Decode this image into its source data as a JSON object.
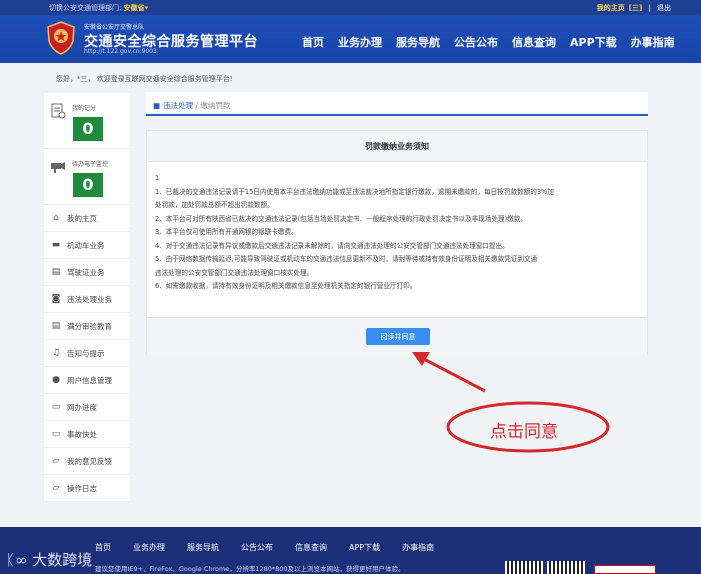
{
  "topbar": {
    "switch_label": "切换公安交通管理部门:",
    "province": "安徽省",
    "home_link": "我的主页",
    "home_sub": "[三]",
    "logout": "退出"
  },
  "header": {
    "org": "安徽省公安厅交警总队",
    "title": "交通安全综合服务管理平台",
    "url": "http://t.122.gov.cn:9003",
    "nav": [
      "首页",
      "业务办理",
      "服务导航",
      "公告公布",
      "信息查询",
      "APP下载",
      "办事指南"
    ]
  },
  "welcome": "您好，*三，  欢迎登录互联网交通安全综合服务管理平台!",
  "sidebar": {
    "score_label": "我的记分",
    "score_value": "0",
    "monitor_label": "待办电子监控",
    "monitor_value": "0",
    "items": [
      {
        "label": "我的主页",
        "icon": "home-icon"
      },
      {
        "label": "机动车业务",
        "icon": "car-icon"
      },
      {
        "label": "驾驶证业务",
        "icon": "license-icon"
      },
      {
        "label": "违法处理业务",
        "icon": "camera-icon"
      },
      {
        "label": "满分审验教育",
        "icon": "card-icon"
      },
      {
        "label": "告知与提示",
        "icon": "bell-icon"
      },
      {
        "label": "用户信息管理",
        "icon": "user-icon"
      },
      {
        "label": "网办进度",
        "icon": "progress-icon"
      },
      {
        "label": "事故快处",
        "icon": "accident-icon"
      },
      {
        "label": "我的意见反馈",
        "icon": "feedback-icon"
      },
      {
        "label": "操作日志",
        "icon": "log-icon"
      }
    ]
  },
  "breadcrumb": {
    "parent": "违法处理",
    "sep": " / ",
    "current": "缴纳罚款"
  },
  "notice": {
    "title": "罚款缴纳业务须知",
    "lines": [
      "1",
      "1、已裁决的交通违法记录请于15日内使用本平台违法缴纳功能或至违法裁决地所指定银行缴款，逾期未缴款的，每日按罚款数额的3%加",
      "处罚款，加处罚款总额不超出罚款数额。",
      "2、本平台可对所有陕西省已裁决的交通违法记录(包括当场处罚决定书、一般程序处理的行政处罚决定书以及非现场处理)缴款。",
      "3、本平台仅可使用所有开通网银的银联卡缴费。",
      "4、对于交通违法记录有异议或缴款后交通违法记录未解除的，请向交通违法处理的公安交管部门交通违法处理窗口提出。",
      "5、由于网络数据传输延迟,可能导致驾驶证或机动车的交通违法信息更新不及时，请耐等待或持有效身份证明及相关缴款凭证到交通",
      "违法处理的公安交管部门交通违法处理窗口核实处理。",
      "6、如需缴款收据，请持有效身份证明及相关缴款信息至处理机关指定的银行营业厅打印。"
    ],
    "agree_button": "阅读并同意"
  },
  "annotation": {
    "text": "点击同意",
    "color": "#d22a2a"
  },
  "footer": {
    "nav": [
      "首页",
      "业务办理",
      "服务导航",
      "公告公布",
      "信息查询",
      "APP下载",
      "办事指南"
    ],
    "tip": "建议您使用IE9+、FireFox、Google Chrome，分辨率1280*800及以上浏览本网站，获得更好用户体验。",
    "watermark": "大数跨境"
  }
}
